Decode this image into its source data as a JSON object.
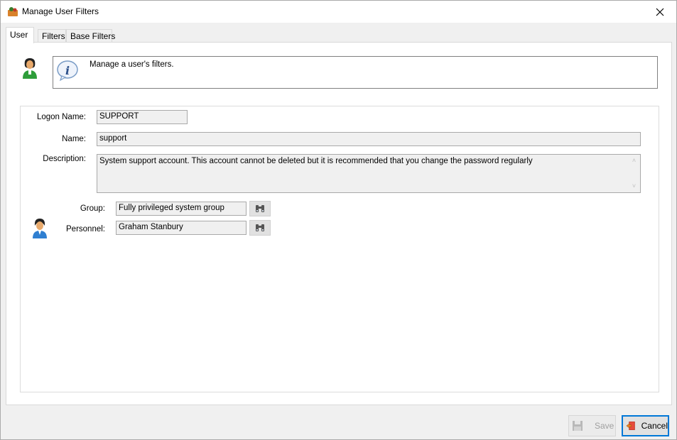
{
  "window": {
    "title": "Manage User Filters",
    "icon": "user-filters-icon",
    "close_icon": "close-icon"
  },
  "tabs": [
    {
      "label": "User",
      "active": true
    },
    {
      "label": "Filters",
      "active": false
    },
    {
      "label": "Base Filters",
      "active": false
    }
  ],
  "info": {
    "icon": "info-icon",
    "text": "Manage a user's filters."
  },
  "form": {
    "logon_name_label": "Logon Name:",
    "logon_name_value": "SUPPORT",
    "name_label": "Name:",
    "name_value": "support",
    "description_label": "Description:",
    "description_value": "System support account. This account cannot be deleted but it is recommended that you change the password regularly",
    "group_label": "Group:",
    "group_value": "Fully privileged system group",
    "personnel_label": "Personnel:",
    "personnel_value": "Graham Stanbury"
  },
  "buttons": {
    "save_label": "Save",
    "save_enabled": false,
    "cancel_label": "Cancel"
  },
  "colors": {
    "focus_border": "#0078d7",
    "field_background": "#f0f0f0"
  }
}
